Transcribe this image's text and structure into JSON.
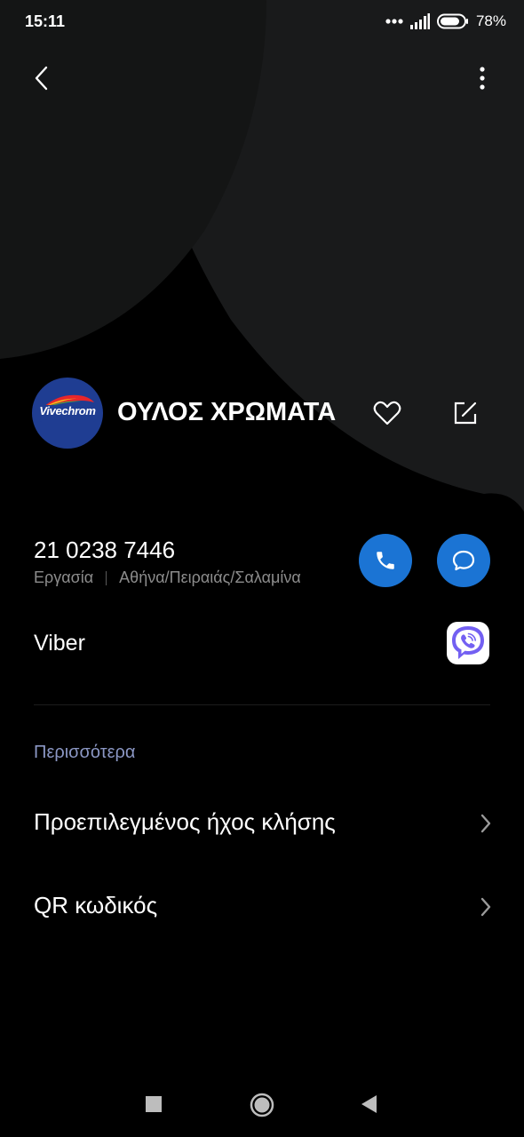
{
  "status_bar": {
    "time": "15:11",
    "battery": "78%"
  },
  "contact": {
    "avatar_text": "Vivechrom",
    "name": "ΟΥΛΟΣ ΧΡΩΜΑΤΑ"
  },
  "phone": {
    "number": "21 0238 7446",
    "label": "Εργασία",
    "location": "Αθήνα/Πειραιάς/Σαλαμίνα"
  },
  "viber": {
    "label": "Viber"
  },
  "more_section": {
    "header": "Περισσότερα",
    "items": [
      {
        "label": "Προεπιλεγμένος ήχος κλήσης"
      },
      {
        "label": "QR κωδικός"
      }
    ]
  },
  "colors": {
    "accent_blue": "#1b74d4",
    "viber_purple": "#7360f2",
    "section_header": "#8b97c4"
  },
  "icons": {
    "back": "chevron-left-icon",
    "menu": "more-vert-icon",
    "favorite": "heart-icon",
    "edit": "edit-icon",
    "call": "phone-icon",
    "message": "message-icon",
    "viber": "viber-icon"
  }
}
